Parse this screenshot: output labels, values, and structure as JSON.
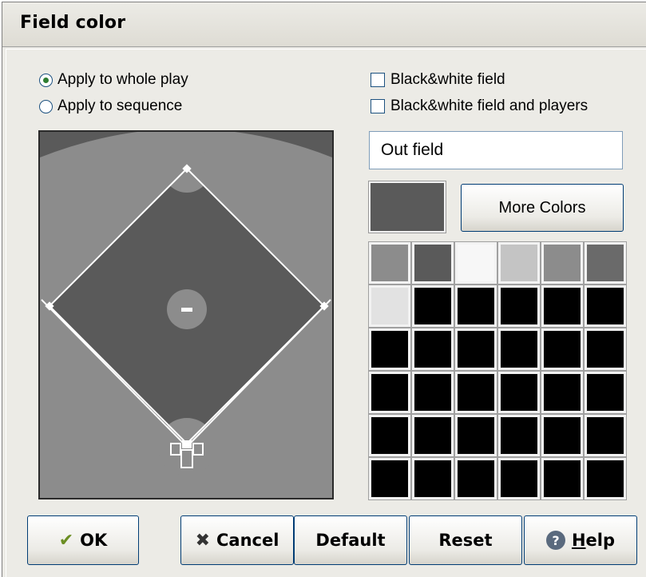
{
  "dialog": {
    "title": "Field color"
  },
  "options": {
    "apply_whole": "Apply to whole play",
    "apply_sequence": "Apply to sequence",
    "bw_field": "Black&white field",
    "bw_field_players": "Black&white field and players"
  },
  "selected": {
    "apply_whole": true,
    "apply_sequence": false,
    "bw_field": false,
    "bw_field_players": false
  },
  "area_name": "Out field",
  "more_colors_label": "More Colors",
  "field_colors": {
    "outfield": "#5a5a5a",
    "grass_upper": "#8c8c8c",
    "infield": "#5a5a5a",
    "dirt_circles": "#8c8c8c",
    "lines": "#ffffff"
  },
  "current_color": "#5a5a5a",
  "palette": [
    [
      "#8c8c8c",
      "#5a5a5a",
      "#f7f7f7",
      "#c4c4c4",
      "#8c8c8c",
      "#6a6a6a"
    ],
    [
      "#e2e2e2",
      "#000000",
      "#000000",
      "#000000",
      "#000000",
      "#000000"
    ],
    [
      "#000000",
      "#000000",
      "#000000",
      "#000000",
      "#000000",
      "#000000"
    ],
    [
      "#000000",
      "#000000",
      "#000000",
      "#000000",
      "#000000",
      "#000000"
    ],
    [
      "#000000",
      "#000000",
      "#000000",
      "#000000",
      "#000000",
      "#000000"
    ],
    [
      "#000000",
      "#000000",
      "#000000",
      "#000000",
      "#000000",
      "#000000"
    ]
  ],
  "buttons": {
    "ok": "OK",
    "cancel": "Cancel",
    "default": "Default",
    "reset": "Reset",
    "help_prefix": "H",
    "help_rest": "elp"
  },
  "icons": {
    "ok": "checkmark-icon",
    "cancel": "x-icon",
    "help": "help-icon"
  }
}
